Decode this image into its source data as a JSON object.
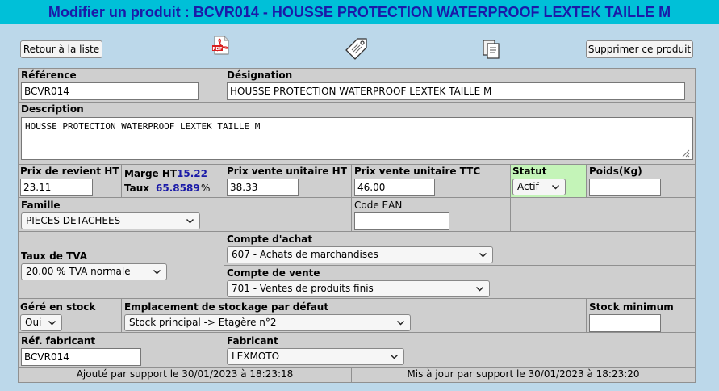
{
  "title": "Modifier un produit : BCVR014 - HOUSSE PROTECTION WATERPROOF LEXTEK TAILLE M",
  "toolbar": {
    "back_label": "Retour à la liste",
    "delete_label": "Supprimer ce produit",
    "icons": [
      "pdf-icon",
      "price-tag-icon",
      "duplicate-icon"
    ]
  },
  "reference": {
    "label": "Référence",
    "value": "BCVR014"
  },
  "designation": {
    "label": "Désignation",
    "value": "HOUSSE PROTECTION WATERPROOF LEXTEK TAILLE M"
  },
  "description": {
    "label": "Description",
    "value": "HOUSSE PROTECTION WATERPROOF LEXTEK TAILLE M"
  },
  "pricing": {
    "cost_label": "Prix de revient HT",
    "cost_value": "23.11",
    "margin_label": "Marge HT",
    "margin_value": "15.22",
    "rate_label": "Taux",
    "rate_value": "65.8589",
    "rate_unit": "%",
    "unit_ht_label": "Prix vente unitaire HT",
    "unit_ht_value": "38.33",
    "unit_ttc_label": "Prix vente unitaire TTC",
    "unit_ttc_value": "46.00",
    "status_label": "Statut",
    "status_value": "Actif",
    "weight_label": "Poids(Kg)",
    "weight_value": ""
  },
  "family": {
    "label": "Famille",
    "value": "PIECES DETACHEES"
  },
  "ean": {
    "label": "Code EAN",
    "value": ""
  },
  "tva": {
    "label": "Taux de TVA",
    "value": "20.00 % TVA normale"
  },
  "purchase_account": {
    "label": "Compte d'achat",
    "value": "607 - Achats de marchandises"
  },
  "sales_account": {
    "label": "Compte de vente",
    "value": "701 - Ventes de produits finis"
  },
  "stock": {
    "managed_label": "Géré en stock",
    "managed_value": "Oui",
    "location_label": "Emplacement de stockage par défaut",
    "location_value": "Stock principal -> Etagère n°2",
    "min_label": "Stock minimum",
    "min_value": ""
  },
  "manufacturer_ref": {
    "label": "Réf. fabricant",
    "value": "BCVR014"
  },
  "manufacturer": {
    "label": "Fabricant",
    "value": "LEXMOTO"
  },
  "footer": {
    "added": "Ajouté par support le 30/01/2023 à 18:23:18",
    "updated": "Mis à jour par support le 30/01/2023 à 18:23:20"
  },
  "colors": {
    "title_bg": "#00c0d8",
    "title_text": "#1a1aa8",
    "page_bg": "#bcd8ea",
    "cell_bg": "#cfcfcf",
    "status_bg": "#c4f4b8",
    "value_blue": "#1a1aa8"
  }
}
